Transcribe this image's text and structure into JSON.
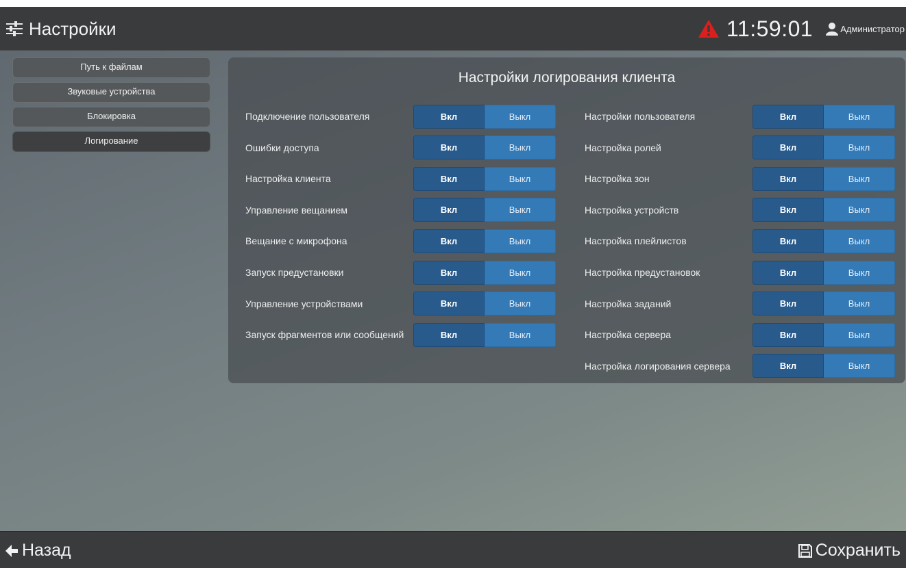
{
  "header": {
    "title": "Настройки",
    "time": "11:59:01",
    "user": "Администратор"
  },
  "sidebar": {
    "items": [
      {
        "label": "Путь к файлам",
        "active": false
      },
      {
        "label": "Звуковые устройства",
        "active": false
      },
      {
        "label": "Блокировка",
        "active": false
      },
      {
        "label": "Логирование",
        "active": true
      }
    ]
  },
  "panel": {
    "title": "Настройки логирования клиента",
    "on_label": "Вкл",
    "off_label": "Выкл",
    "left": [
      "Подключение пользователя",
      "Ошибки доступа",
      "Настройка клиента",
      "Управление вещанием",
      "Вещание с микрофона",
      "Запуск предустановки",
      "Управление устройствами",
      "Запуск фрагментов или сообщений"
    ],
    "right": [
      "Настройки пользователя",
      "Настройка ролей",
      "Настройка зон",
      "Настройка устройств",
      "Настройка плейлистов",
      "Настройка предустановок",
      "Настройка заданий",
      "Настройка сервера",
      "Настройка логирования сервера"
    ]
  },
  "footer": {
    "back_label": "Назад",
    "save_label": "Сохранить"
  },
  "colors": {
    "header_bg": "#3a3b3c",
    "toggle_on": "#285a8c",
    "toggle_off": "#337ab7",
    "warning": "#d9201f"
  }
}
